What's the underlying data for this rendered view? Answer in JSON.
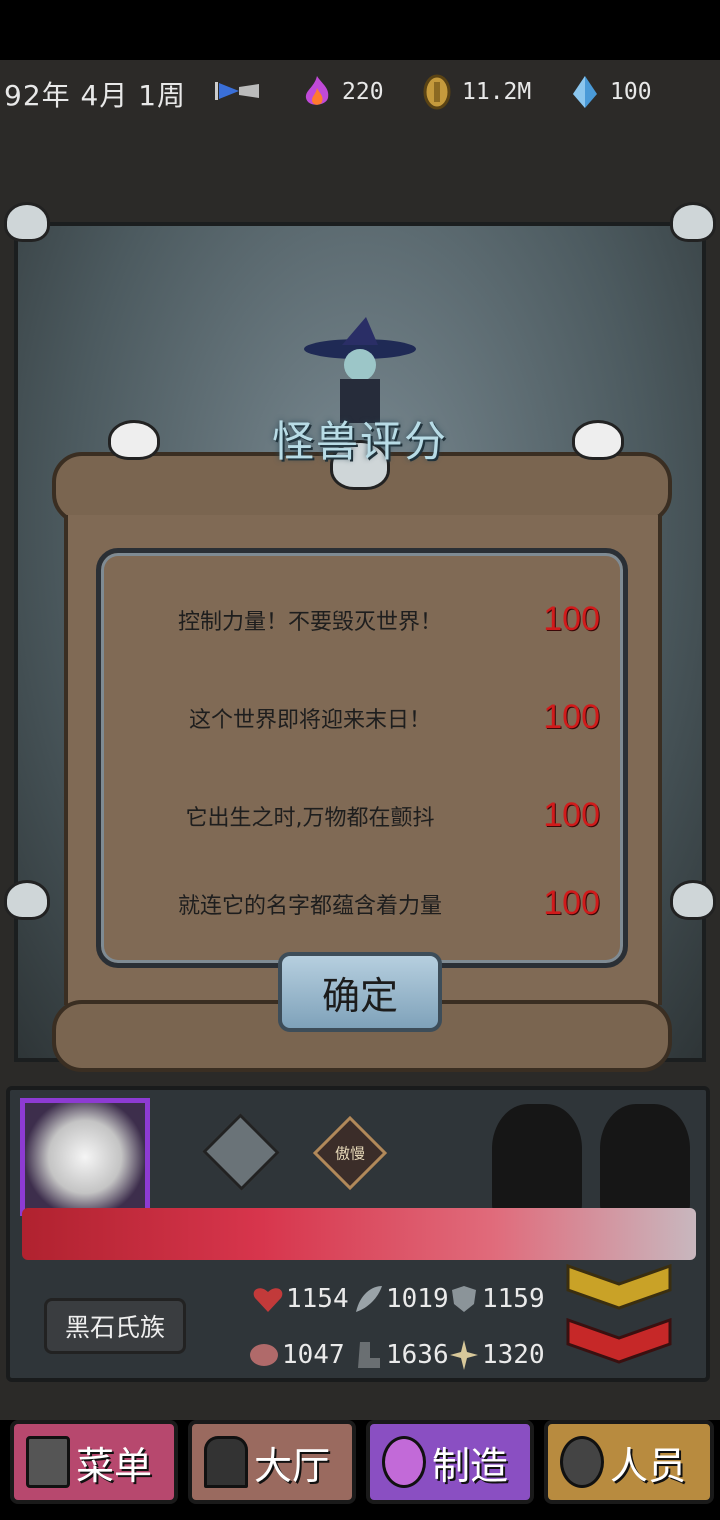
{
  "topbar": {
    "date": "92年 4月 1周",
    "resources": [
      {
        "name": "flame",
        "value": "220"
      },
      {
        "name": "coin",
        "value": "11.2M"
      },
      {
        "name": "crystal",
        "value": "100"
      }
    ]
  },
  "dialog": {
    "title": "怪兽评分",
    "rows": [
      {
        "text": "控制力量！不要毁灭世界！",
        "value": "100"
      },
      {
        "text": "这个世界即将迎来末日！",
        "value": "100"
      },
      {
        "text": "它出生之时,万物都在颤抖",
        "value": "100"
      },
      {
        "text": "就连它的名字都蕴含着力量",
        "value": "100"
      }
    ],
    "confirm": "确定"
  },
  "panel": {
    "trait": "傲慢",
    "clan": "黑石氏族",
    "stats": [
      {
        "icon": "heart-icon",
        "value": "1154"
      },
      {
        "icon": "feather-icon",
        "value": "1019"
      },
      {
        "icon": "shield-icon",
        "value": "1159"
      },
      {
        "icon": "brain-icon",
        "value": "1047"
      },
      {
        "icon": "boot-icon",
        "value": "1636"
      },
      {
        "icon": "sparkle-icon",
        "value": "1320"
      }
    ]
  },
  "nav": [
    {
      "label": "菜单"
    },
    {
      "label": "大厅"
    },
    {
      "label": "制造"
    },
    {
      "label": "人员"
    }
  ],
  "colors": {
    "score": "#d01b1b",
    "nav1": "#b7486e",
    "nav2": "#9a6a5f",
    "nav3": "#8a4fc2",
    "nav4": "#b88b3f"
  }
}
